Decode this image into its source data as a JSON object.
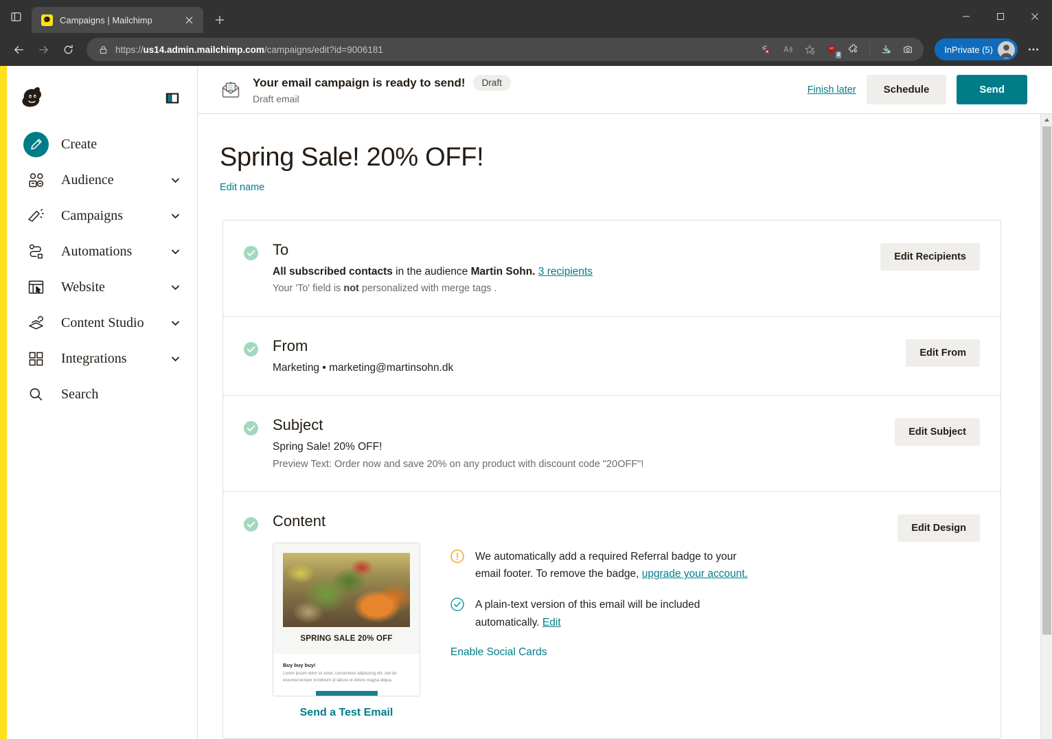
{
  "browser": {
    "tab": {
      "title": "Campaigns | Mailchimp",
      "favicon": "mailchimp-favicon"
    },
    "new_tab_label": "+",
    "address": {
      "protocol": "https://",
      "host": "us14.admin.mailchimp.com",
      "path": "/campaigns/edit?id=9006181"
    },
    "toolbar_icons": [
      "browser-essentials-icon",
      "read-aloud-icon",
      "add-favorite-icon",
      "ublock-origin-icon",
      "extensions-icon",
      "downloads-icon",
      "screenshot-icon"
    ],
    "ublock_badge": "4",
    "profile": {
      "label": "InPrivate (5)"
    },
    "more_label": "...",
    "window_controls": [
      "minimize",
      "maximize",
      "close"
    ]
  },
  "sidebar": {
    "logo": "mailchimp-freddie-logo",
    "collapse_icon": "collapse-sidebar-icon",
    "items": [
      {
        "label": "Create",
        "icon": "pencil-icon",
        "chevron": false,
        "primary": true
      },
      {
        "label": "Audience",
        "icon": "audience-icon",
        "chevron": true
      },
      {
        "label": "Campaigns",
        "icon": "megaphone-icon",
        "chevron": true
      },
      {
        "label": "Automations",
        "icon": "automations-icon",
        "chevron": true
      },
      {
        "label": "Website",
        "icon": "website-icon",
        "chevron": true
      },
      {
        "label": "Content Studio",
        "icon": "content-studio-icon",
        "chevron": true
      },
      {
        "label": "Integrations",
        "icon": "grid-icon",
        "chevron": true
      },
      {
        "label": "Search",
        "icon": "search-icon",
        "chevron": false
      }
    ]
  },
  "header": {
    "icon": "email-draft-icon",
    "title": "Your email campaign is ready to send!",
    "badge": "Draft",
    "subtitle": "Draft email",
    "finish_later": "Finish later",
    "schedule": "Schedule",
    "send": "Send"
  },
  "page": {
    "title": "Spring Sale! 20% OFF!",
    "edit_name": "Edit name"
  },
  "sections": {
    "to": {
      "title": "To",
      "line_bold": "All subscribed contacts",
      "line_mid": " in the audience ",
      "line_audience": "Martin Sohn.",
      "recipients_link": "3 recipients",
      "sub_pre": "Your 'To' field is ",
      "sub_bold": "not",
      "sub_post": " personalized with merge tags .",
      "button": "Edit Recipients"
    },
    "from": {
      "title": "From",
      "value": "Marketing • marketing@martinsohn.dk",
      "button": "Edit From"
    },
    "subject": {
      "title": "Subject",
      "value": "Spring Sale! 20% OFF!",
      "preview_text": "Preview Text: Order now and save 20% on any product with discount code \"20OFF\"!",
      "button": "Edit Subject"
    },
    "content": {
      "title": "Content",
      "button": "Edit Design",
      "preview": {
        "hero_caption": "SPRING SALE 20% OFF",
        "body_heading": "Buy buy buy!",
        "body_text": "Lorem ipsum dolor sit amet, consectetur adipiscing elit, sed do eiusmod tempor incididunt ut labore et dolore magna aliqua.",
        "send_test": "Send a Test Email"
      },
      "notices": [
        {
          "icon": "warning-icon",
          "text_pre": "We automatically add a required Referral badge to your email footer. To remove the badge, ",
          "link": "upgrade your account."
        },
        {
          "icon": "check-circle-icon",
          "text_pre": "A plain-text version of this email will be included automatically. ",
          "link": "Edit"
        }
      ],
      "enable_social": "Enable Social Cards"
    }
  },
  "colors": {
    "accent_teal": "#007c89",
    "brand_yellow": "#ffe01b",
    "check_green": "#a0d9bd",
    "warning_orange": "#f5a623",
    "button_gray": "#efeeea"
  }
}
